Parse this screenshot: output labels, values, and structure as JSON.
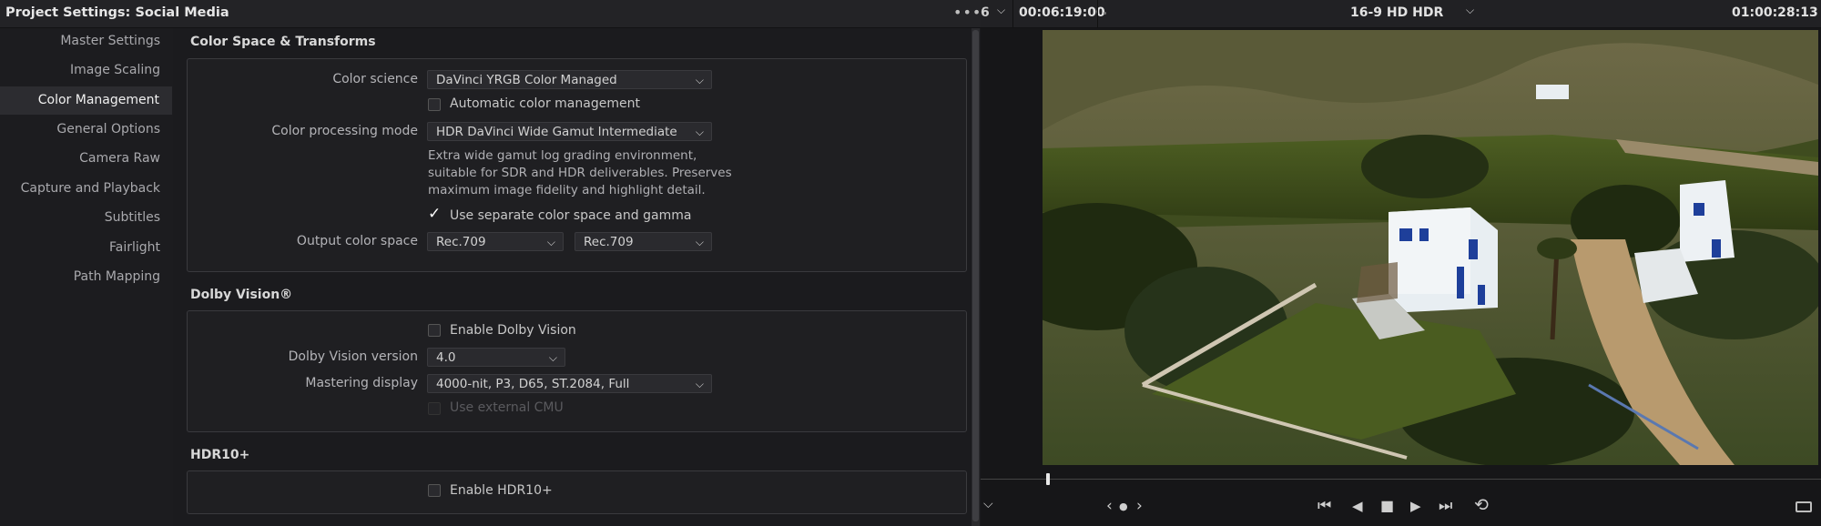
{
  "window": {
    "title_prefix": "Project Settings:",
    "project_name": "Social Media",
    "more_menu": "•••"
  },
  "sidebar": {
    "items": [
      {
        "label": "Master Settings",
        "active": false
      },
      {
        "label": "Image Scaling",
        "active": false
      },
      {
        "label": "Color Management",
        "active": true
      },
      {
        "label": "General Options",
        "active": false
      },
      {
        "label": "Camera Raw",
        "active": false
      },
      {
        "label": "Capture and Playback",
        "active": false
      },
      {
        "label": "Subtitles",
        "active": false
      },
      {
        "label": "Fairlight",
        "active": false
      },
      {
        "label": "Path Mapping",
        "active": false
      }
    ]
  },
  "color_space": {
    "title": "Color Space & Transforms",
    "color_science_label": "Color science",
    "color_science_value": "DaVinci YRGB Color Managed",
    "auto_color_label": "Automatic color management",
    "auto_color_checked": false,
    "processing_mode_label": "Color processing mode",
    "processing_mode_value": "HDR DaVinci Wide Gamut Intermediate",
    "description_lines": [
      "Extra wide gamut log grading environment,",
      "suitable for SDR and HDR deliverables. Preserves",
      "maximum image fidelity and highlight detail."
    ],
    "separate_label": "Use separate color space and gamma",
    "separate_checked": true,
    "output_label": "Output color space",
    "output_space_value": "Rec.709",
    "output_gamma_value": "Rec.709"
  },
  "dolby": {
    "title": "Dolby Vision®",
    "enable_label": "Enable Dolby Vision",
    "enable_checked": false,
    "version_label": "Dolby Vision version",
    "version_value": "4.0",
    "mastering_label": "Mastering display",
    "mastering_value": "4000-nit, P3, D65, ST.2084, Full",
    "external_cmu_label": "Use external CMU",
    "external_cmu_checked": false
  },
  "hdr10": {
    "title": "HDR10+",
    "enable_label": "Enable HDR10+",
    "enable_checked": false
  },
  "viewer": {
    "partial_left": "6",
    "timecode_in": "00:06:19:00",
    "timeline_name": "16-9 HD HDR",
    "timecode_out": "01:00:28:13",
    "playhead_position": 0.08
  },
  "icons": {
    "chevron": "⌵",
    "checkmark": "✓",
    "first_frame": "⏮",
    "prev_frame": "◀",
    "stop": "■",
    "play": "▶",
    "last_frame": "⏭",
    "loop": "⟲",
    "jog_left": "‹",
    "jog_dot": "●",
    "jog_right": "›"
  },
  "colors": {
    "accent": "#2c2c30",
    "panel_border": "#3a3a3e",
    "background": "#1b1b1e"
  }
}
